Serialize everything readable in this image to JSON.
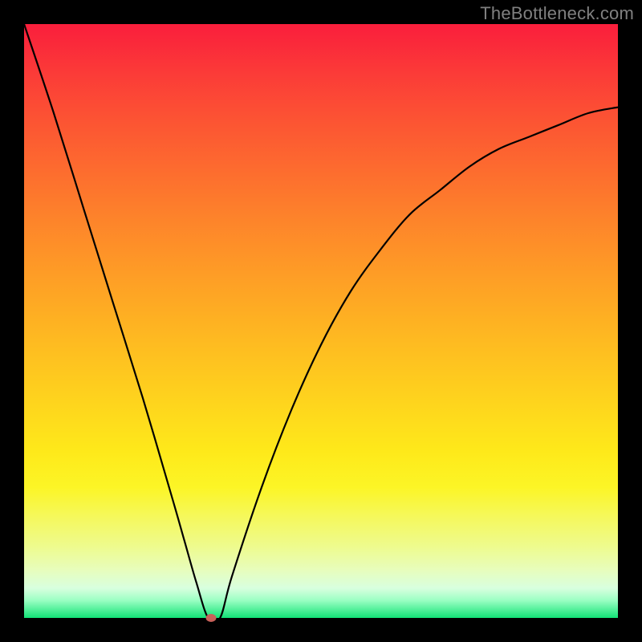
{
  "watermark": "TheBottleneck.com",
  "chart_data": {
    "type": "line",
    "title": "",
    "xlabel": "",
    "ylabel": "",
    "xlim": [
      0,
      100
    ],
    "ylim": [
      0,
      100
    ],
    "x": [
      0,
      5,
      10,
      15,
      20,
      25,
      27,
      29,
      31,
      33,
      35,
      40,
      45,
      50,
      55,
      60,
      65,
      70,
      75,
      80,
      85,
      90,
      95,
      100
    ],
    "values": [
      100,
      85,
      69,
      53,
      37,
      20,
      13,
      6,
      0,
      0,
      7,
      22,
      35,
      46,
      55,
      62,
      68,
      72,
      76,
      79,
      81,
      83,
      85,
      86
    ],
    "marker": {
      "x": 31.5,
      "y": 0,
      "color": "#c9615a"
    },
    "background_gradient": {
      "type": "vertical",
      "stops": [
        {
          "pos": 0.0,
          "color": "#fa1e3c"
        },
        {
          "pos": 0.5,
          "color": "#fec120"
        },
        {
          "pos": 0.8,
          "color": "#f5f85c"
        },
        {
          "pos": 1.0,
          "color": "#12e276"
        }
      ]
    }
  }
}
